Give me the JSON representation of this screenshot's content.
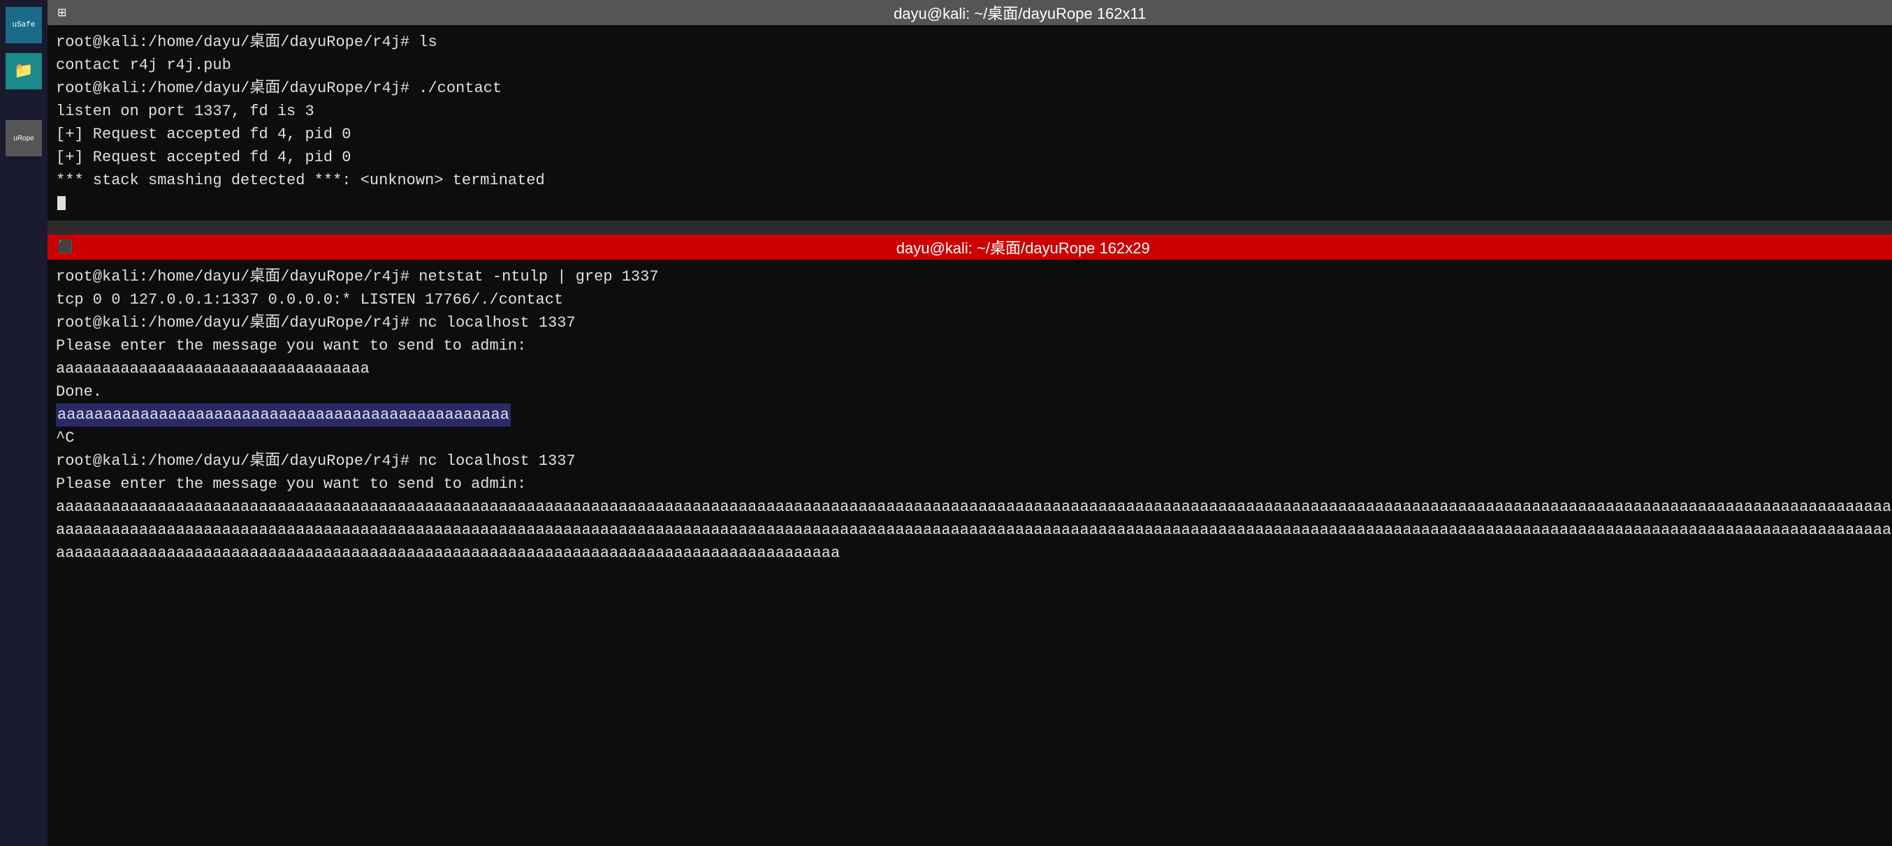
{
  "sidebar": {
    "usafe_label": "uSafe",
    "rope_label": "uRope"
  },
  "terminal_top": {
    "titlebar_title": "dayu@kali: ~/桌面/dayuRope 162x11",
    "lines": [
      "root@kali:/home/dayu/桌面/dayuRope/r4j# ls",
      "contact  r4j  r4j.pub",
      "root@kali:/home/dayu/桌面/dayuRope/r4j# ./contact",
      "listen on port 1337, fd is 3",
      "[+] Request accepted fd 4, pid 0",
      "[+] Request accepted fd 4, pid 0",
      "*** stack smashing detected ***: <unknown> terminated"
    ]
  },
  "terminal_bottom": {
    "titlebar_title": "dayu@kali: ~/桌面/dayuRope 162x29",
    "lines": [
      "root@kali:/home/dayu/桌面/dayuRope/r4j# netstat -ntulp | grep 1337",
      "tcp        0      0 127.0.0.1:1337          0.0.0.0:*               LISTEN      17766/./contact",
      "root@kali:/home/dayu/桌面/dayuRope/r4j# nc localhost 1337",
      "Please enter the message you want to send to admin:",
      "aaaaaaaaaaaaaaaaaaaaaaaaaaaaaaaaaa",
      "Done.",
      "aaaaaaaaaaaaaaaaaaaaaaaaaaaaaaaaaaaaaaaaaaaaaaaaa",
      "^C",
      "root@kali:/home/dayu/桌面/dayuRope/r4j# nc localhost 1337",
      "Please enter the message you want to send to admin:",
      "aaaaaaaaaaaaaaaaaaaaaaaaaaaaaaaaaaaaaaaaaaaaaaaaaaaaaaaaaaaaaaaaaaaaaaaaaaaaaaaaaaaaaaaaaaaaaaaaaaaaaaaaaaaaaaaaaaaaaaaaaaaaaaaaaaaaaaaaaaaaaaaaaaaaaaaaaaaaaaaaaaaaaaaaaaaaaaaaaaaaaaaaaaaaaaaaaaaaaaaaaaaaaaaa",
      "aaaaaaaaaaaaaaaaaaaaaaaaaaaaaaaaaaaaaaaaaaaaaaaaaaaaaaaaaaaaaaaaaaaaaaaaaaaaaaaaaaaaaaaaaaaaaaaaaaaaaaaaaaaaaaaaaaaaaaaaaaaaaaaaaaaaaaaaaaaaaaaaaaaaaaaaaaaaaaaaaaaaaaaaaaaaaaaaaaaaaaaaaaaaaaaaaaaaaaaaaaaaaaaa",
      "aaaaaaaaaaaaaaaaaaaaaaaaaaaaaaaaaaaaaaaaaaaaaaaaaaaaaaaaaaaaaaaaaaaaaaaaaaaaaaaaaaaaa"
    ]
  },
  "colors": {
    "terminal_bg": "#0d0d0d",
    "active_titlebar": "#cc0000",
    "inactive_titlebar": "#555555",
    "text": "#e0e0e0",
    "sidebar_bg": "#1a1a2e",
    "highlight_bg": "#1a1a6a"
  }
}
